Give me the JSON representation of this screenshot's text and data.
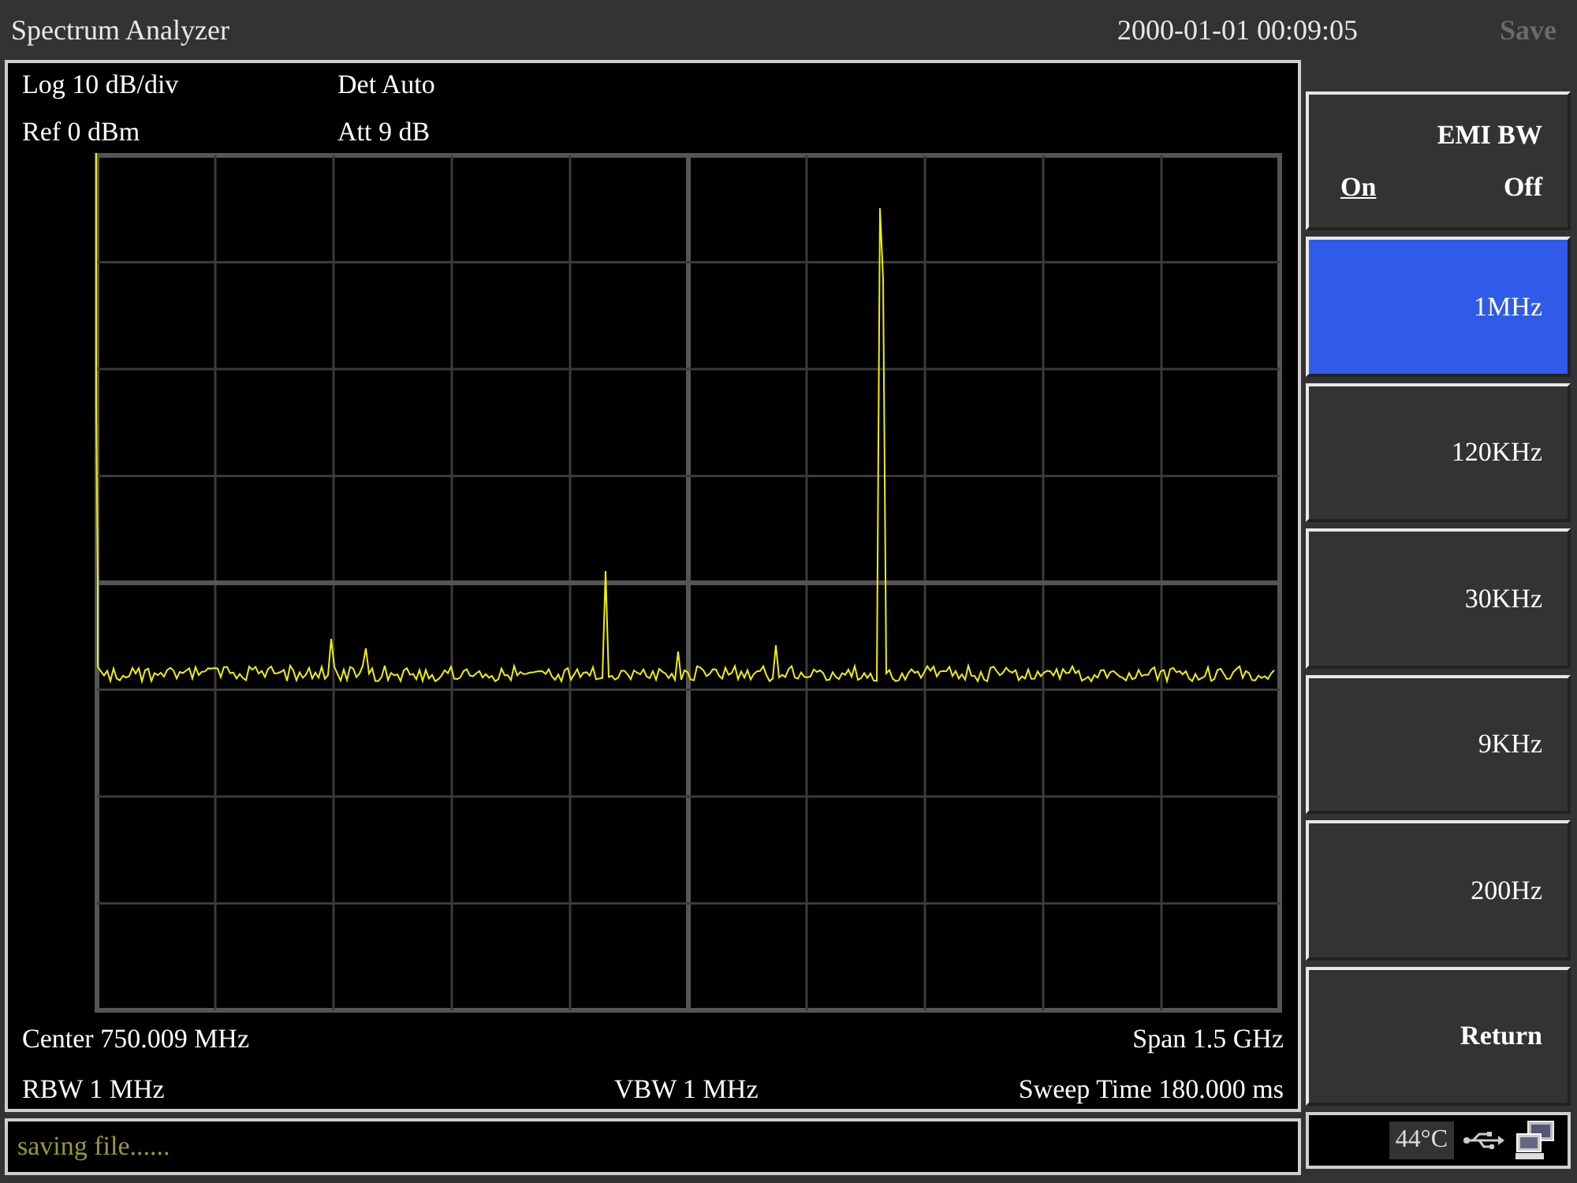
{
  "window": {
    "title": "Spectrum Analyzer",
    "datetime": "2000-01-01 00:09:05",
    "menu_title": {
      "text": "Save",
      "disabled": true
    }
  },
  "display": {
    "top_left": [
      "Log 10 dB/div",
      "Ref 0 dBm"
    ],
    "top_mid": [
      "Det Auto",
      "Att 9 dB"
    ],
    "bottom": {
      "center": "Center 750.009 MHz",
      "span": "Span 1.5 GHz",
      "rbw": "RBW 1 MHz",
      "vbw": "VBW 1 MHz",
      "sweep": "Sweep Time 180.000 ms"
    }
  },
  "softkeys": [
    {
      "kind": "toggle",
      "label": "EMI BW",
      "options": [
        {
          "label": "On",
          "selected": true
        },
        {
          "label": "Off",
          "selected": false
        }
      ],
      "selected": false
    },
    {
      "kind": "value",
      "label": "1MHz",
      "selected": true
    },
    {
      "kind": "value",
      "label": "120KHz",
      "selected": false
    },
    {
      "kind": "value",
      "label": "30KHz",
      "selected": false
    },
    {
      "kind": "value",
      "label": "9KHz",
      "selected": false
    },
    {
      "kind": "value",
      "label": "200Hz",
      "selected": false
    },
    {
      "kind": "action",
      "label": "Return",
      "selected": false
    }
  ],
  "status_bar": {
    "message": "saving file......",
    "temperature": "44°C"
  }
}
